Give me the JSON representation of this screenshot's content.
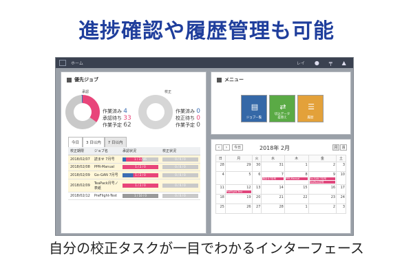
{
  "headline": "進捗確認や履歴管理も可能",
  "footline": "自分の校正タスクが一目でわかるインターフェース",
  "app": {
    "nav_home": "ホーム",
    "user_name": "レイ"
  },
  "priority_panel": {
    "title": "優先ジョブ",
    "approval_label": "承認",
    "proof_label": "校正",
    "approval_stats": [
      {
        "label": "作業済み",
        "value": "4"
      },
      {
        "label": "承認待ち",
        "value": "33"
      },
      {
        "label": "作業予定",
        "value": "62"
      }
    ],
    "proof_stats": [
      {
        "label": "作業済み",
        "value": "0"
      },
      {
        "label": "校正待ち",
        "value": "0"
      },
      {
        "label": "作業予定",
        "value": "0"
      }
    ],
    "tabs": [
      "今日",
      "3 日以内",
      "7 日以内"
    ],
    "active_tab": "7 日以内",
    "columns": [
      "校正期限",
      "ジョブ名",
      "承認状況",
      "校正状況"
    ],
    "rows": [
      {
        "date": "2018/02/07",
        "job": "読ませ 7月号",
        "approval": "1 / 3 / 46",
        "proof": "0 / 0 / 0"
      },
      {
        "date": "2018/02/08",
        "job": "PPR-Manual",
        "approval": "1 / 2 / 0",
        "proof": "0 / 0 / 0"
      },
      {
        "date": "2018/02/09",
        "job": "Go-GAN 7月号",
        "approval": "1 / 2 / 0",
        "proof": "0 / 0 / 0"
      },
      {
        "date": "2018/02/09",
        "job": "TeaPack月号ノ表紙",
        "approval": "1 / 2 / 0",
        "proof": "0 / 0 / 0"
      },
      {
        "date": "2018/02/12",
        "job": "PreFlight-Test",
        "approval": "1 / 10 / 0",
        "proof": "0 / 0 / 0"
      }
    ],
    "colors": {
      "approval_done": "#3b6db3",
      "approval_wait": "#e8457a",
      "approval_plan": "#c9c9c9"
    }
  },
  "menu_panel": {
    "title": "メニュー",
    "buttons": [
      {
        "label": "ジョブ一覧",
        "icon": "document-list-icon",
        "color": "#3568a7"
      },
      {
        "label": "切込データ\n差替え",
        "icon": "swap-arrows-icon",
        "color": "#5aaa45"
      },
      {
        "label": "履歴",
        "icon": "stack-icon",
        "color": "#e3a13a"
      }
    ]
  },
  "calendar_panel": {
    "today_label": "今日",
    "month_title": "2018年 2月",
    "view_buttons": [
      "月",
      "週"
    ],
    "weekdays": [
      "日",
      "月",
      "火",
      "水",
      "木",
      "金",
      "土"
    ],
    "weeks": [
      [
        "28",
        "29",
        "30",
        "31",
        "1",
        "2",
        "3"
      ],
      [
        "4",
        "5",
        "6",
        "7",
        "8",
        "9",
        "10"
      ],
      [
        "11",
        "12",
        "13",
        "14",
        "15",
        "16",
        "17"
      ],
      [
        "18",
        "19",
        "20",
        "21",
        "22",
        "23",
        "24"
      ],
      [
        "25",
        "26",
        "27",
        "28",
        "1",
        "2",
        "3"
      ]
    ],
    "events": [
      {
        "label": "読ませ7月号",
        "week": 1,
        "day": 3
      },
      {
        "label": "PPR-Manual",
        "week": 1,
        "day": 4
      },
      {
        "label": "Go-GAN 7月号",
        "week": 1,
        "day": 5
      },
      {
        "label": "TeaPack月号",
        "week": 1,
        "day": 5
      },
      {
        "label": "PreFlight-Test",
        "week": 2,
        "day": 1
      }
    ]
  }
}
